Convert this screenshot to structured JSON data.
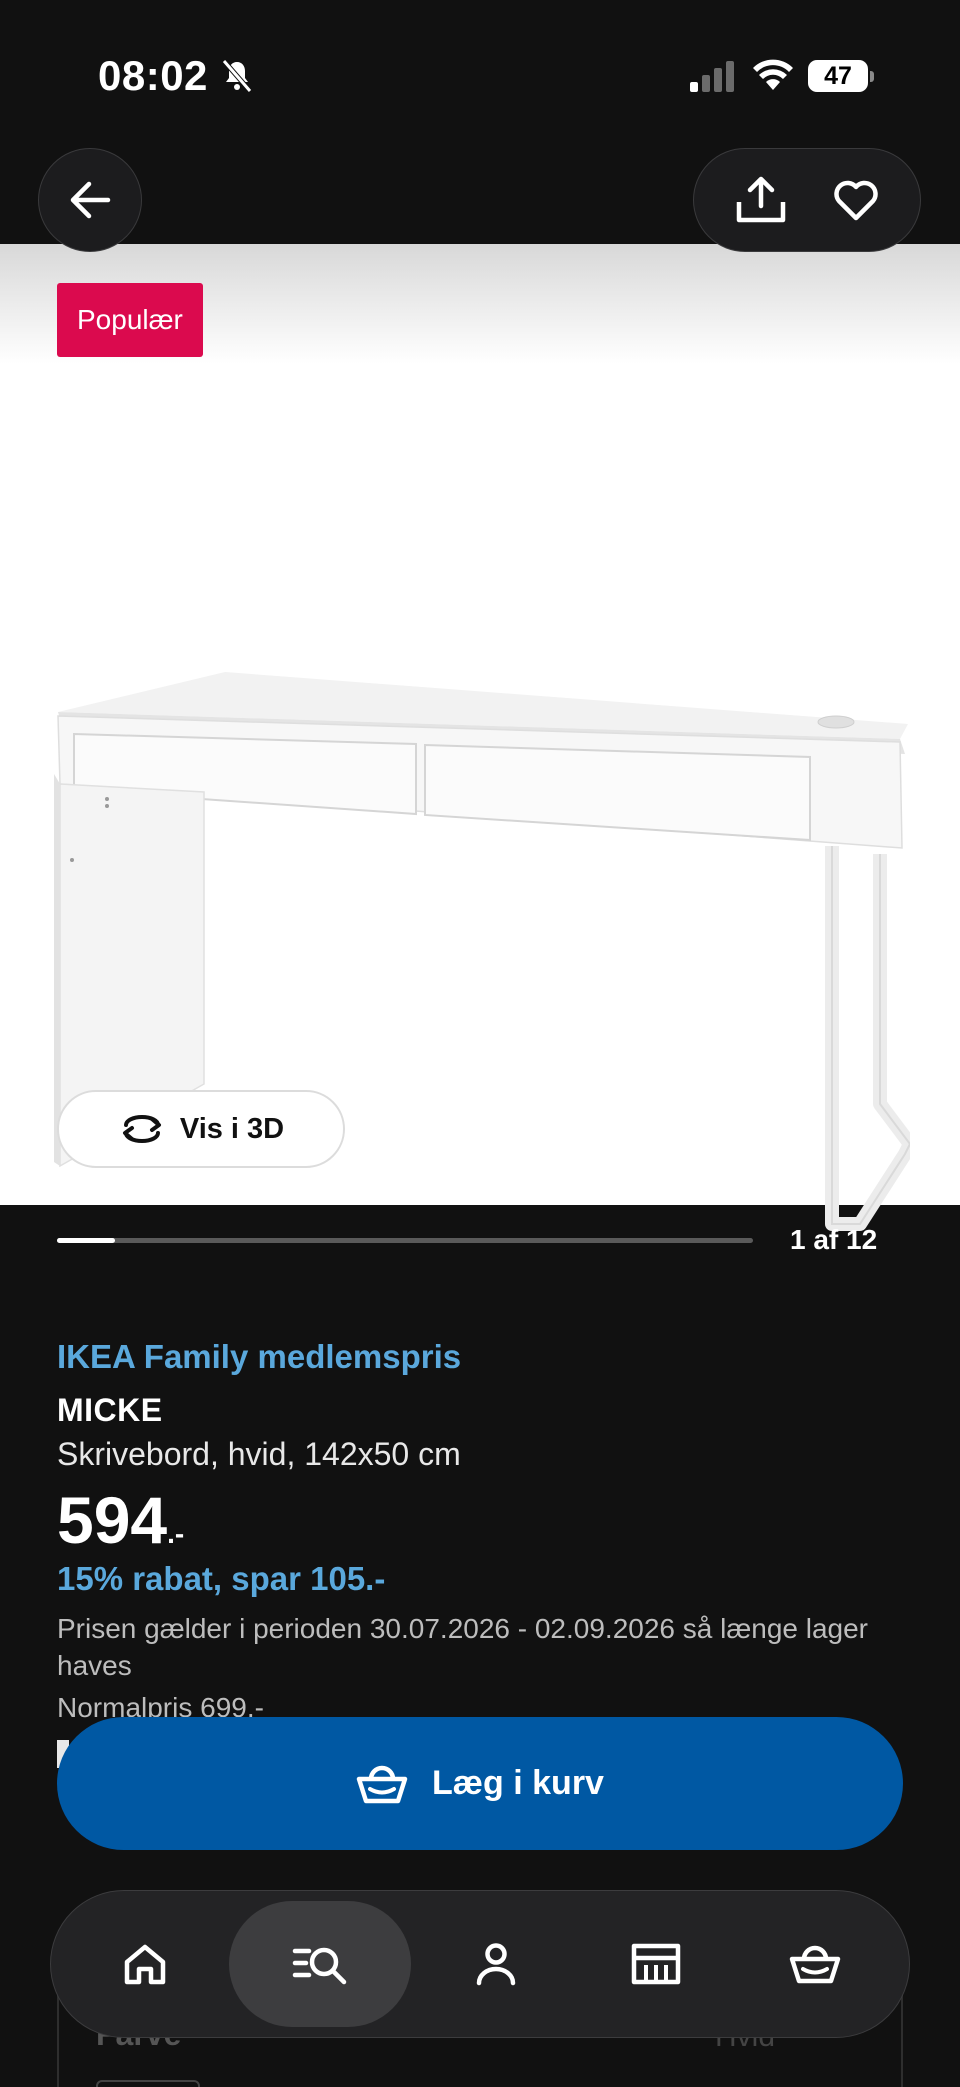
{
  "status_bar": {
    "time": "08:02",
    "battery": "47"
  },
  "product": {
    "badge": "Populær",
    "view_3d_label": "Vis i 3D",
    "pager": {
      "current": 1,
      "total": 12,
      "label": "1 af 12"
    },
    "family_label": "IKEA Family medlemspris",
    "name": "MICKE",
    "description": "Skrivebord, hvid, 142x50 cm",
    "price_main": "594",
    "price_suffix": ".-",
    "discount": "15% rabat, spar 105.-",
    "period": "Prisen gælder i perioden 30.07.2026 - 02.09.2026 så længe lager haves",
    "normal_price": "Normalpris 699.-",
    "variant_label": "Farve",
    "variant_value": "Hvid"
  },
  "cart_button": {
    "label": "Læg i kurv"
  },
  "nav": {
    "items": [
      {
        "name": "home",
        "icon": "home-icon"
      },
      {
        "name": "search",
        "icon": "search-list-icon",
        "active": true
      },
      {
        "name": "profile",
        "icon": "person-icon"
      },
      {
        "name": "stores",
        "icon": "store-icon"
      },
      {
        "name": "cart",
        "icon": "basket-icon"
      }
    ]
  },
  "colors": {
    "background": "#111111",
    "accent_blue": "#0058a3",
    "family_blue": "#5aa8dc",
    "badge_red": "#db0a4e"
  }
}
